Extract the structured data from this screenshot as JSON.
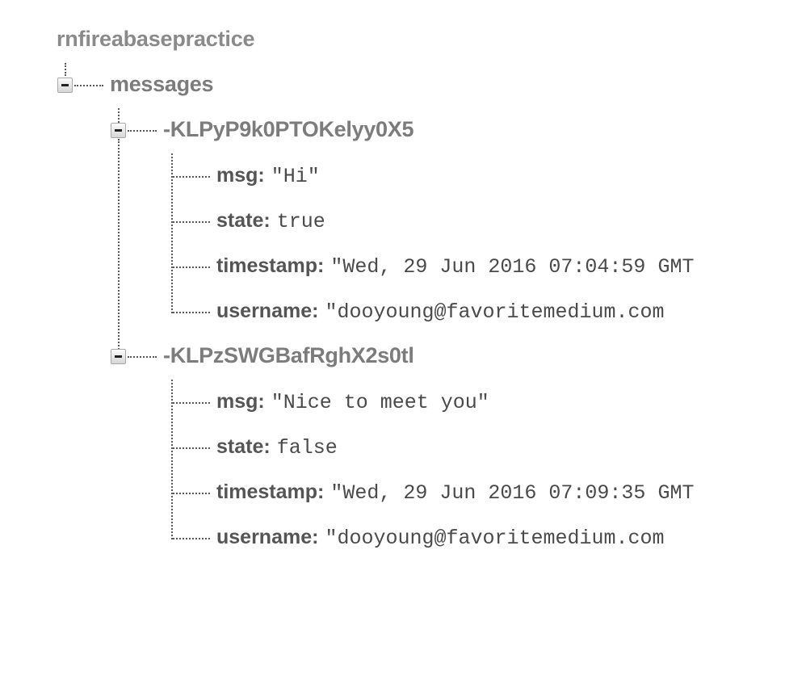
{
  "root": {
    "name": "rnfireabasepractice"
  },
  "messages": {
    "name": "messages",
    "children": [
      {
        "key": "-KLPyP9k0PTOKelyy0X5",
        "fields": [
          {
            "key": "msg:",
            "value": "\"Hi\""
          },
          {
            "key": "state:",
            "value": "true"
          },
          {
            "key": "timestamp:",
            "value": "\"Wed, 29 Jun 2016 07:04:59 GMT"
          },
          {
            "key": "username:",
            "value": "\"dooyoung@favoritemedium.com"
          }
        ]
      },
      {
        "key": "-KLPzSWGBafRghX2s0tl",
        "fields": [
          {
            "key": "msg:",
            "value": "\"Nice to meet you\""
          },
          {
            "key": "state:",
            "value": "false"
          },
          {
            "key": "timestamp:",
            "value": "\"Wed, 29 Jun 2016 07:09:35 GMT"
          },
          {
            "key": "username:",
            "value": "\"dooyoung@favoritemedium.com"
          }
        ]
      }
    ]
  },
  "icons": {
    "collapse": "minus-square-icon"
  },
  "colors": {
    "node_text": "#7c7c7c",
    "key_text": "#555555",
    "value_text": "#4a4a4a",
    "connector": "#5a5a5a"
  }
}
